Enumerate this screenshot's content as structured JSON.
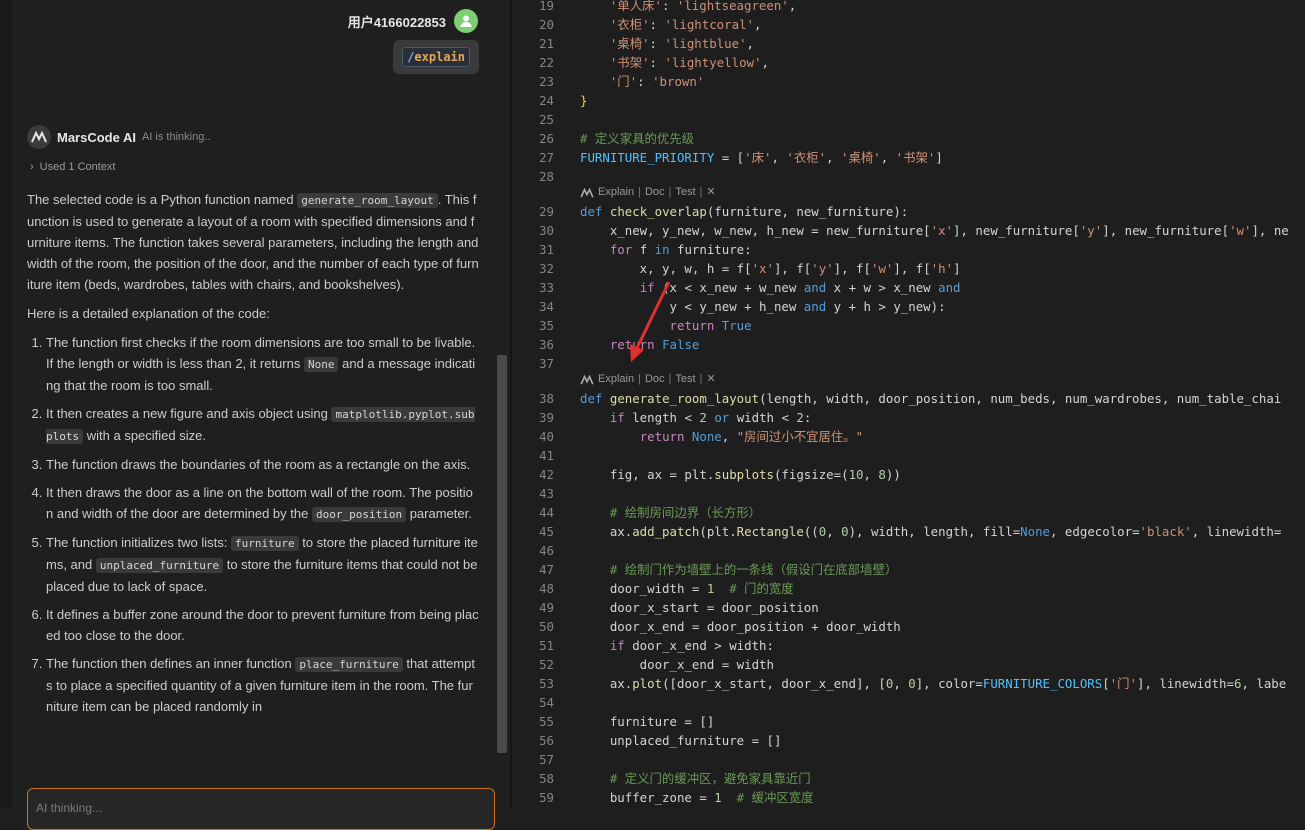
{
  "user": {
    "name": "用户4166022853",
    "command_slash": "/",
    "command_text": "explain"
  },
  "assistant": {
    "name": "MarsCode AI",
    "status": "AI is thinking..",
    "context_label": "Used 1 Context",
    "intro": {
      "p1": "The selected code is a Python function named",
      "code": "generate_room_layout",
      "p2": ". This function is used to generate a layout of a room with specified dimensions and furniture items. The function takes several parameters, including the length and width of the room, the position of the door, and the number of each type of furniture item (beds, wardrobes, tables with chairs, and bookshelves)."
    },
    "detail_heading": "Here is a detailed explanation of the code:",
    "list": [
      {
        "a": "The function first checks if the room dimensions are too small to be livable. If the length or width is less than 2, it returns",
        "code": "None",
        "b": "and a message indicating that the room is too small."
      },
      {
        "a": "It then creates a new figure and axis object using",
        "code": "matplotlib.pyplot.subplots",
        "b": "with a specified size."
      },
      {
        "a": "The function draws the boundaries of the room as a rectangle on the axis.",
        "code": "",
        "b": ""
      },
      {
        "a": "It then draws the door as a line on the bottom wall of the room. The position and width of the door are determined by the",
        "code": "door_position",
        "b": "parameter."
      },
      {
        "a": "The function initializes two lists:",
        "code": "furniture",
        "b": "to store the placed furniture items, and",
        "code2": "unplaced_furniture",
        "c": "to store the furniture items that could not be placed due to lack of space."
      },
      {
        "a": "It defines a buffer zone around the door to prevent furniture from being placed too close to the door.",
        "code": "",
        "b": ""
      },
      {
        "a": "The function then defines an inner function",
        "code": "place_furniture",
        "b": "that attempts to place a specified quantity of a given furniture item in the room. The furniture item can be placed randomly in"
      }
    ]
  },
  "input": {
    "placeholder": "AI thinking..."
  },
  "code_lens": {
    "explain": "Explain",
    "doc": "Doc",
    "test": "Test",
    "close": "✕"
  },
  "editor": {
    "lines": [
      {
        "n": "19",
        "text": "    '单人床': 'lightseagreen',"
      },
      {
        "n": "20",
        "text": "    '衣柜': 'lightcoral',"
      },
      {
        "n": "21",
        "text": "    '桌椅': 'lightblue',"
      },
      {
        "n": "22",
        "text": "    '书架': 'lightyellow',"
      },
      {
        "n": "23",
        "text": "    '门': 'brown'"
      },
      {
        "n": "24",
        "text": "}"
      },
      {
        "n": "25",
        "text": ""
      },
      {
        "n": "26",
        "text": "# 定义家具的优先级"
      },
      {
        "n": "27",
        "text": "FURNITURE_PRIORITY = ['床', '衣柜', '桌椅', '书架']"
      },
      {
        "n": "28",
        "text": ""
      },
      {
        "n": "29",
        "text": "def check_overlap(furniture, new_furniture):"
      },
      {
        "n": "30",
        "text": "    x_new, y_new, w_new, h_new = new_furniture['x'], new_furniture['y'], new_furniture['w'], ne"
      },
      {
        "n": "31",
        "text": "    for f in furniture:"
      },
      {
        "n": "32",
        "text": "        x, y, w, h = f['x'], f['y'], f['w'], f['h']"
      },
      {
        "n": "33",
        "text": "        if (x < x_new + w_new and x + w > x_new and"
      },
      {
        "n": "34",
        "text": "            y < y_new + h_new and y + h > y_new):"
      },
      {
        "n": "35",
        "text": "            return True"
      },
      {
        "n": "36",
        "text": "    return False"
      },
      {
        "n": "37",
        "text": ""
      },
      {
        "n": "38",
        "text": "def generate_room_layout(length, width, door_position, num_beds, num_wardrobes, num_table_chai"
      },
      {
        "n": "39",
        "text": "    if length < 2 or width < 2:"
      },
      {
        "n": "40",
        "text": "        return None, \"房间过小不宜居住。\""
      },
      {
        "n": "41",
        "text": ""
      },
      {
        "n": "42",
        "text": "    fig, ax = plt.subplots(figsize=(10, 8))"
      },
      {
        "n": "43",
        "text": ""
      },
      {
        "n": "44",
        "text": "    # 绘制房间边界（长方形）"
      },
      {
        "n": "45",
        "text": "    ax.add_patch(plt.Rectangle((0, 0), width, length, fill=None, edgecolor='black', linewidth="
      },
      {
        "n": "46",
        "text": ""
      },
      {
        "n": "47",
        "text": "    # 绘制门作为墙壁上的一条线（假设门在底部墙壁）"
      },
      {
        "n": "48",
        "text": "    door_width = 1  # 门的宽度"
      },
      {
        "n": "49",
        "text": "    door_x_start = door_position"
      },
      {
        "n": "50",
        "text": "    door_x_end = door_position + door_width"
      },
      {
        "n": "51",
        "text": "    if door_x_end > width:"
      },
      {
        "n": "52",
        "text": "        door_x_end = width"
      },
      {
        "n": "53",
        "text": "    ax.plot([door_x_start, door_x_end], [0, 0], color=FURNITURE_COLORS['门'], linewidth=6, labe"
      },
      {
        "n": "54",
        "text": ""
      },
      {
        "n": "55",
        "text": "    furniture = []"
      },
      {
        "n": "56",
        "text": "    unplaced_furniture = []"
      },
      {
        "n": "57",
        "text": ""
      },
      {
        "n": "58",
        "text": "    # 定义门的缓冲区，避免家具靠近门"
      },
      {
        "n": "59",
        "text": "    buffer_zone = 1  # 缓冲区宽度"
      }
    ]
  },
  "colors": {
    "accent_orange": "#c96f1e",
    "avatar_green": "#7ccf73",
    "arrow_red": "#e03131"
  }
}
